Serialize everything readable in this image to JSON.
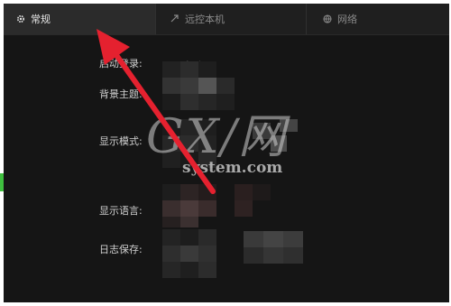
{
  "tabs": [
    {
      "label": "常规",
      "icon": "gear-icon",
      "active": true
    },
    {
      "label": "远控本机",
      "icon": "remote-icon",
      "active": false
    },
    {
      "label": "网络",
      "icon": "network-icon",
      "active": false
    }
  ],
  "settings": {
    "startup_label": "启动登录:",
    "startup_checkbox": {
      "label": "开机启动",
      "checked": true
    },
    "theme_label": "背景主题:",
    "display_mode_label": "显示模式:",
    "language_label": "显示语言:",
    "log_save_label": "日志保存:"
  },
  "watermark": {
    "big": "GX/网",
    "small": "system.com"
  },
  "colors": {
    "accent": "#e8743b",
    "arrow": "#e5212f",
    "background": "#151515"
  }
}
